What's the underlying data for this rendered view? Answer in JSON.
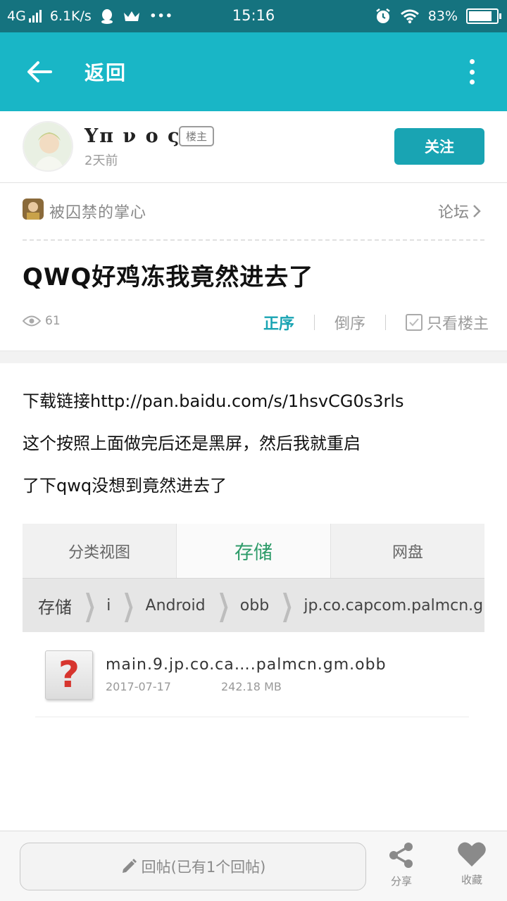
{
  "status_bar": {
    "network": "4G",
    "speed": "6.1K/s",
    "more": "•••",
    "time": "15:16",
    "battery_percent": "83%",
    "battery_level": 0.83
  },
  "app_bar": {
    "title": "返回"
  },
  "author": {
    "name": "Υπ ν ο ς",
    "badge": "楼主",
    "time": "2天前",
    "follow_label": "关注"
  },
  "forum": {
    "name": "被囚禁的掌心",
    "link_label": "论坛"
  },
  "post": {
    "title": "QWQ好鸡冻我竟然进去了",
    "views": "61",
    "sort_asc": "正序",
    "sort_desc": "倒序",
    "only_op": "只看楼主",
    "body_lines": [
      "下载链接http://pan.baidu.com/s/1hsvCG0s3rls",
      "这个按照上面做完后还是黑屏，然后我就重启",
      "了下qwq没想到竟然进去了"
    ]
  },
  "screenshot": {
    "tabs": [
      "分类视图",
      "存储",
      "网盘"
    ],
    "breadcrumbs": [
      "存储",
      "i",
      "Android",
      "obb",
      "jp.co.capcom.palmcn.gm"
    ],
    "file": {
      "name": "main.9.jp.co.ca….palmcn.gm.obb",
      "date": "2017-07-17",
      "size": "242.18 MB",
      "icon": "?"
    }
  },
  "bottom_bar": {
    "reply_placeholder": "回帖(已有1个回帖)",
    "share_label": "分享",
    "favorite_label": "收藏"
  },
  "colors": {
    "accent": "#19b6c6",
    "status_bar": "#15737f",
    "follow_button": "#19a4b3",
    "storage_tab": "#2d9b69"
  }
}
